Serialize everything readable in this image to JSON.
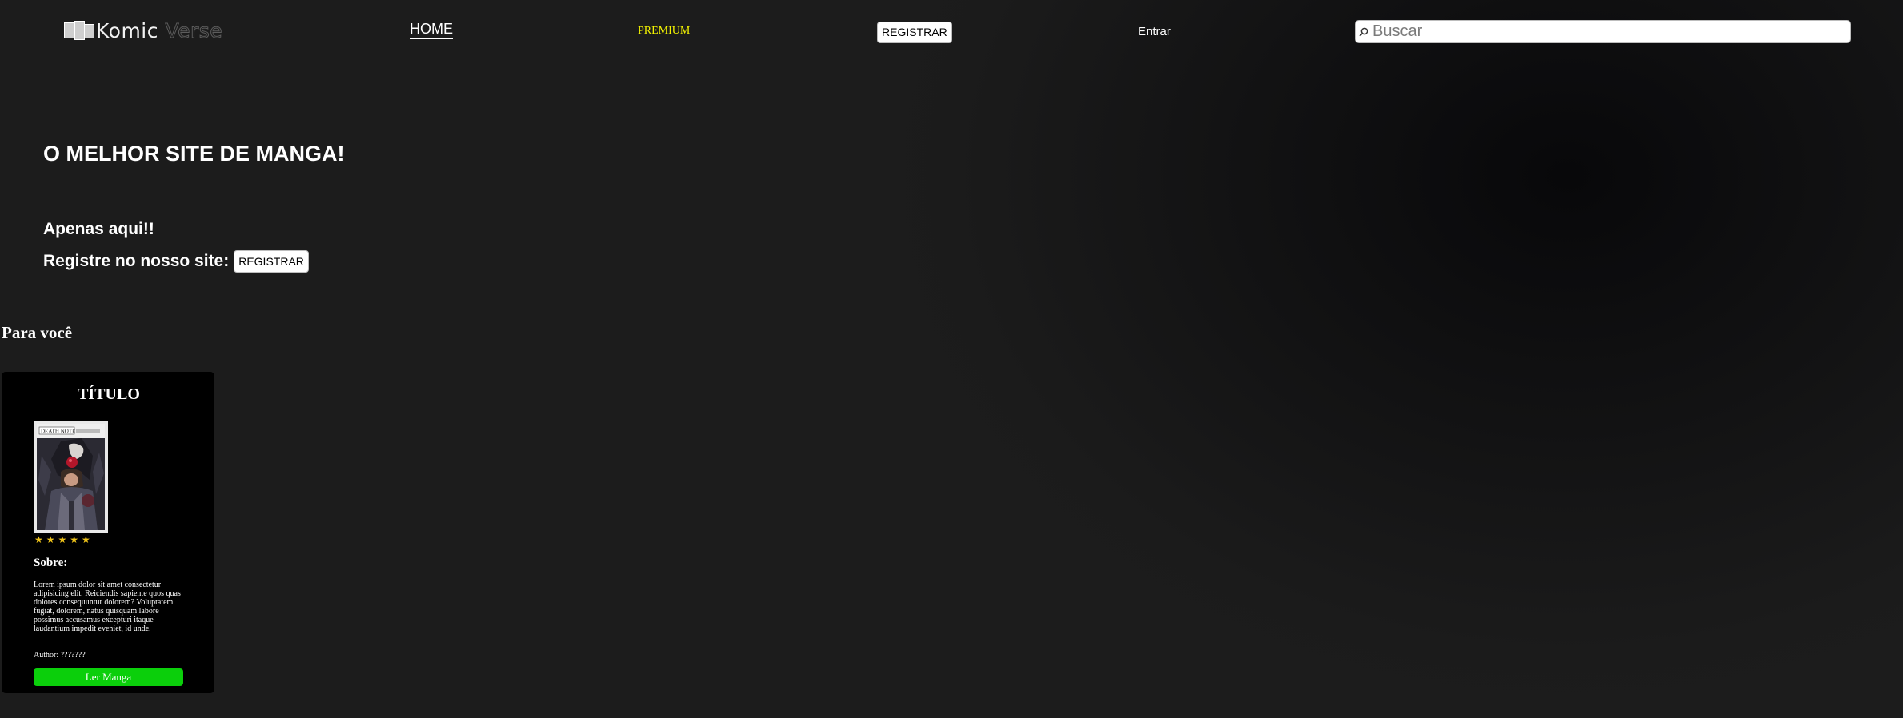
{
  "header": {
    "logo_main": "Komic",
    "logo_ghost": " Verse",
    "nav": {
      "home": "HOME",
      "premium": "PREMIUM",
      "register": "REGISTRAR",
      "login": "Entrar"
    },
    "search": {
      "placeholder": "Buscar",
      "value": ""
    }
  },
  "hero": {
    "title": "O MELHOR SITE DE MANGA!",
    "subtitle": "Apenas aqui!!",
    "cta_text": "Registre no nosso site:",
    "cta_button": "REGISTRAR"
  },
  "section": {
    "title": "Para você"
  },
  "card": {
    "title": "TÍTULO",
    "cover_label": "DEATH NOTE",
    "rating": 5,
    "stars": "★★★★★",
    "about_label": "Sobre:",
    "about_text": "Lorem ipsum dolor sit amet consectetur adipisicing elit. Reiciendis sapiente quos quas dolores consequuntur dolorem? Voluptatem fugiat, dolorem, natus quisquam labore possimus accusamus excepturi itaque laudantium impedit eveniet, id unde.",
    "author": "Author: ???????",
    "read_button": "Ler Manga"
  },
  "colors": {
    "premium": "#f3f301",
    "read_button": "#0bcf0b",
    "stars": "#f0c419"
  }
}
